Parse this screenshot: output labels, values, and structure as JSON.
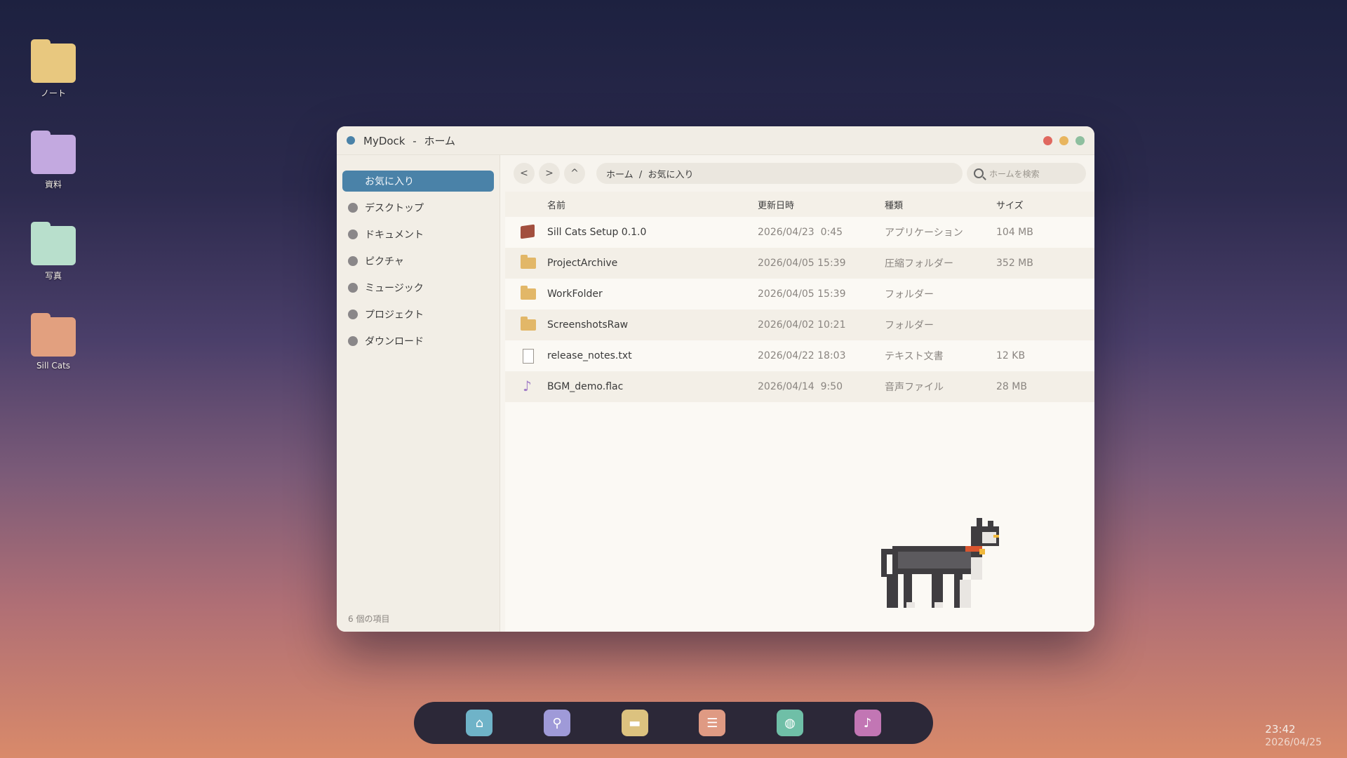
{
  "desktop_icons": [
    {
      "label": "ノート",
      "color": "#e8c87f"
    },
    {
      "label": "資料",
      "color": "#c3a9e0"
    },
    {
      "label": "写真",
      "color": "#b8dfcc"
    },
    {
      "label": "Sill Cats",
      "color": "#e2a07f"
    }
  ],
  "window": {
    "app_name": "MyDock",
    "separator": "-",
    "location": "ホーム",
    "controls": {
      "close_color": "#e0685f",
      "minimize_color": "#e8b55e",
      "maximize_color": "#8ebf9f"
    },
    "accent": "#4a82a8"
  },
  "sidebar": {
    "items": [
      {
        "label": "お気に入り",
        "active": true
      },
      {
        "label": "デスクトップ"
      },
      {
        "label": "ドキュメント"
      },
      {
        "label": "ピクチャ"
      },
      {
        "label": "ミュージック"
      },
      {
        "label": "プロジェクト"
      },
      {
        "label": "ダウンロード"
      }
    ],
    "footer": "6 個の項目"
  },
  "toolbar": {
    "back": "<",
    "forward": ">",
    "up": "^",
    "path": "ホーム  /  お気に入り",
    "search_placeholder": "ホームを検索"
  },
  "columns": {
    "name": "名前",
    "date": "更新日時",
    "type": "種類",
    "size": "サイズ"
  },
  "files": [
    {
      "icon": "package-icon",
      "name": "Sill Cats Setup 0.1.0",
      "date": "2026/04/23  0:45",
      "type": "アプリケーション",
      "size": "104 MB"
    },
    {
      "icon": "folder-icon",
      "name": "ProjectArchive",
      "date": "2026/04/05 15:39",
      "type": "圧縮フォルダー",
      "size": "352 MB"
    },
    {
      "icon": "folder-icon",
      "name": "WorkFolder",
      "date": "2026/04/05 15:39",
      "type": "フォルダー",
      "size": ""
    },
    {
      "icon": "folder-icon",
      "name": "ScreenshotsRaw",
      "date": "2026/04/02 10:21",
      "type": "フォルダー",
      "size": ""
    },
    {
      "icon": "text-file-icon",
      "name": "release_notes.txt",
      "date": "2026/04/22 18:03",
      "type": "テキスト文書",
      "size": "12 KB"
    },
    {
      "icon": "music-note-icon",
      "name": "BGM_demo.flac",
      "date": "2026/04/14  9:50",
      "type": "音声ファイル",
      "size": "28 MB"
    }
  ],
  "dock": [
    {
      "icon": "home-icon",
      "color": "#6fb3c8"
    },
    {
      "icon": "search-icon",
      "color": "#9f9ad8"
    },
    {
      "icon": "folder-icon",
      "color": "#dcc27f"
    },
    {
      "icon": "document-icon",
      "color": "#df9a83"
    },
    {
      "icon": "globe-icon",
      "color": "#6fbfa7"
    },
    {
      "icon": "music-icon",
      "color": "#c276b4"
    }
  ],
  "clock": {
    "time": "23:42",
    "date": "2026/04/25"
  }
}
